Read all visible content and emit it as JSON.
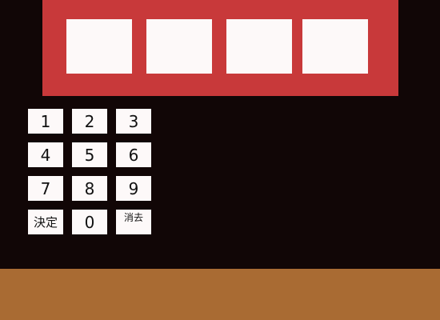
{
  "code_display": {
    "slots": [
      "",
      "",
      "",
      ""
    ]
  },
  "keypad": {
    "keys": [
      "1",
      "2",
      "3",
      "4",
      "5",
      "6",
      "7",
      "8",
      "9",
      "決定",
      "0",
      "消去"
    ]
  },
  "colors": {
    "background": "#110606",
    "panel": "#c8393a",
    "slot": "#fdf9f9",
    "key": "#fdf9f9",
    "floor": "#a96b33"
  }
}
